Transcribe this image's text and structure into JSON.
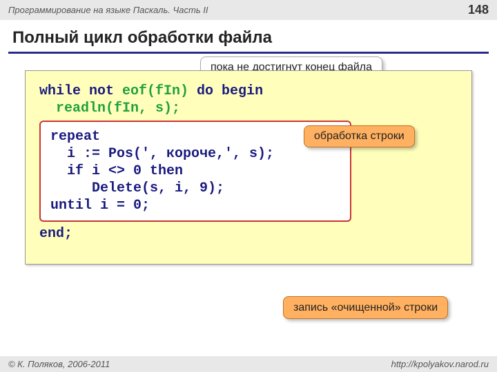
{
  "header": {
    "breadcrumb": "Программирование на языке Паскаль. Часть II",
    "page_number": "148"
  },
  "title": "Полный цикл обработки файла",
  "callouts": {
    "top": "пока не достигнут конец файла",
    "right": "обработка строки",
    "bottom": "запись «очищенной» строки"
  },
  "code": {
    "line1_while": "while not ",
    "line1_eof": "eof(fIn)",
    "line1_do": " do begin",
    "line2_indent": "  ",
    "line2_fn": "readln(fIn, s);",
    "inner1": "repeat",
    "inner2": "  i := Pos(', короче,', s);",
    "inner3": "  if i <> 0 then",
    "inner4": "     Delete(s, i, 9);",
    "inner5": "until i = 0;",
    "line_end": "end;"
  },
  "footer": {
    "copyright": "© К. Поляков, 2006-2011",
    "url": "http://kpolyakov.narod.ru"
  }
}
